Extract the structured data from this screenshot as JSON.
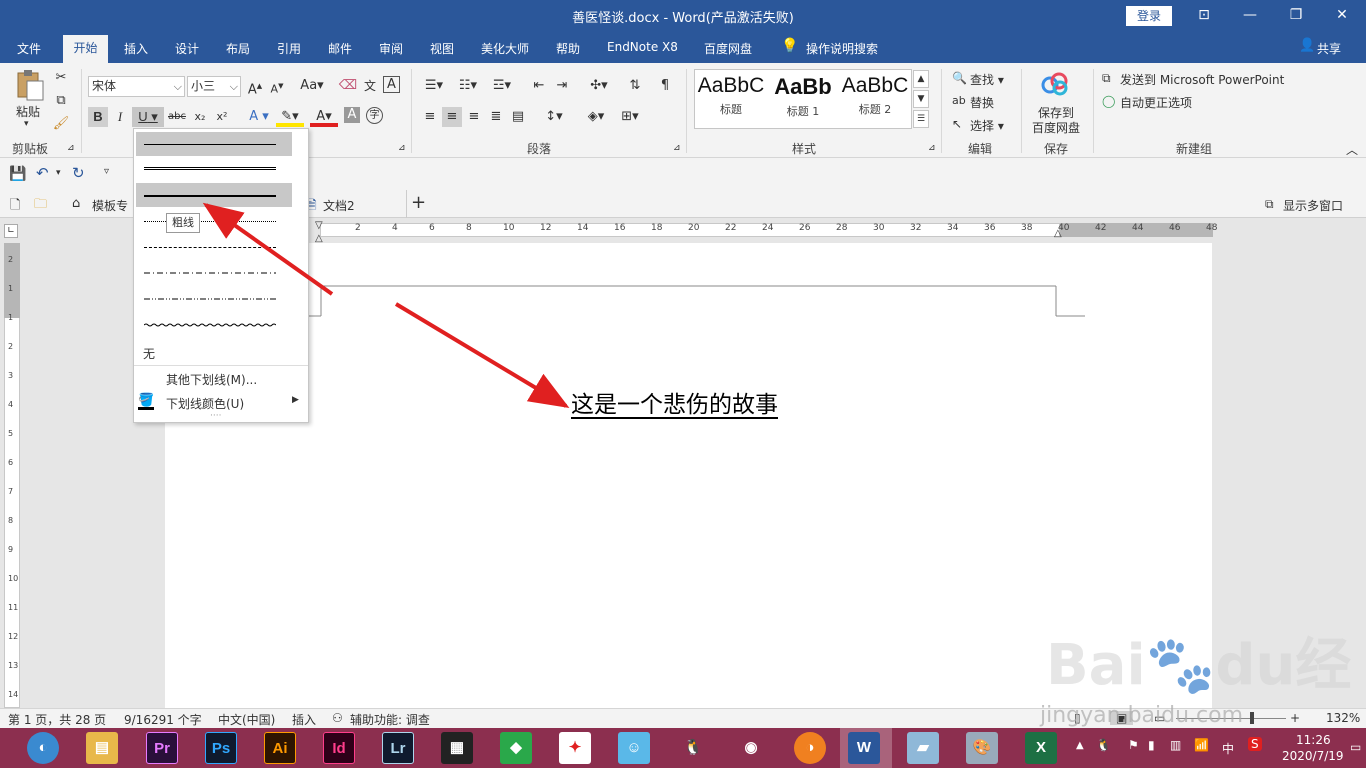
{
  "window": {
    "title": "善医怪谈.docx  -  Word(产品激活失败)",
    "login": "登录"
  },
  "tabs": [
    "文件",
    "开始",
    "插入",
    "设计",
    "布局",
    "引用",
    "邮件",
    "审阅",
    "视图",
    "美化大师",
    "帮助",
    "EndNote X8",
    "百度网盘"
  ],
  "tell_me": "操作说明搜索",
  "share": "共享",
  "ribbon": {
    "clipboard": {
      "paste": "粘贴",
      "label": "剪贴板"
    },
    "font": {
      "name": "宋体",
      "size": "小三",
      "bold": "B",
      "italic": "I",
      "underline": "U",
      "strike": "abc",
      "sub": "x₂",
      "sup": "x²",
      "color_letter": "A"
    },
    "paragraph": {
      "label": "段落"
    },
    "styles": {
      "label": "样式",
      "items": [
        {
          "preview": "AaBbC",
          "name": "标题"
        },
        {
          "preview": "AaBb",
          "name": "标题 1"
        },
        {
          "preview": "AaBbC",
          "name": "标题 2"
        }
      ]
    },
    "editing": {
      "find": "查找",
      "replace": "替换",
      "select": "选择",
      "label": "编辑"
    },
    "save": {
      "line1": "保存到",
      "line2": "百度网盘",
      "label": "保存"
    },
    "new_group": {
      "send": "发送到 Microsoft PowerPoint",
      "autocorrect": "自动更正选项",
      "label": "新建组"
    }
  },
  "doc_tabs": {
    "template": "模板专",
    "doc2": "文档2",
    "multi_window": "显示多窗口"
  },
  "ruler_numbers": [
    "2",
    "4",
    "6",
    "8",
    "10",
    "12",
    "14",
    "16",
    "18",
    "20",
    "22",
    "24",
    "26",
    "28",
    "30",
    "32",
    "34",
    "36",
    "38",
    "40",
    "42",
    "44",
    "46",
    "48"
  ],
  "vruler_numbers": [
    "2",
    "1",
    "1",
    "2",
    "3",
    "4",
    "5",
    "6",
    "7",
    "8",
    "9",
    "10",
    "11",
    "12",
    "13",
    "14"
  ],
  "document": {
    "text": "这是一个悲伤的故事"
  },
  "underline_menu": {
    "tooltip": "粗线",
    "none": "无",
    "more": "其他下划线(M)...",
    "color": "下划线颜色(U)",
    "selected_index": 2
  },
  "statusbar": {
    "page": "第 1 页，共 28 页",
    "words": "9/16291 个字",
    "lang": "中文(中国)",
    "mode": "插入",
    "access": "辅助功能: 调查",
    "zoom": "132%"
  },
  "taskbar": {
    "apps": [
      "Pr",
      "Ps",
      "Ai",
      "Id",
      "Lr"
    ],
    "time": "11:26",
    "date": "2020/7/19",
    "ime": "中"
  },
  "colors": {
    "accent": "#2b579a",
    "taskbar": "#8c2f4f",
    "arrow": "#e02020"
  },
  "watermark": {
    "brand": "Bai",
    "cn": "经验",
    "url": "jingyan.baidu.com"
  }
}
